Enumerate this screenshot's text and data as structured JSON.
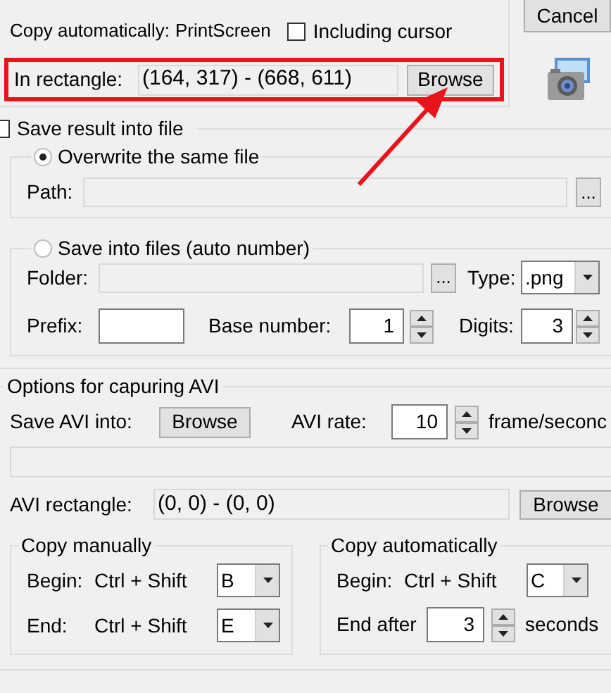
{
  "cancel_button": "Cancel",
  "copy_auto": {
    "label": "Copy automatically:",
    "key": "PrintScreen"
  },
  "including_cursor": {
    "label": "Including cursor",
    "checked": false
  },
  "rectangle": {
    "label": "In rectangle:",
    "value": "(164, 317) - (668, 611)",
    "button": "Browse",
    "highlighted": true
  },
  "save_result": {
    "label": "Save result into file",
    "checked": false
  },
  "overwrite": {
    "label": "Overwrite the same file",
    "selected": true,
    "path_label": "Path:",
    "browse": "..."
  },
  "auto_number": {
    "label": "Save into files (auto number)",
    "selected": false,
    "folder_label": "Folder:",
    "browse": "...",
    "type_label": "Type:",
    "type_value": ".png",
    "prefix_label": "Prefix:",
    "base_label": "Base number:",
    "base_value": "1",
    "digits_label": "Digits:",
    "digits_value": "3"
  },
  "avi": {
    "title": "Options for capuring AVI",
    "save_label": "Save AVI into:",
    "browse": "Browse",
    "rate_label": "AVI rate:",
    "rate_value": "10",
    "rate_unit": "frame/seconc",
    "rect_label": "AVI rectangle:",
    "rect_value": "(0, 0) - (0, 0)",
    "rect_button": "Browse"
  },
  "copy_manually": {
    "title": "Copy manually",
    "rows": [
      {
        "label": "Begin:",
        "keys": "Ctrl + Shift",
        "value": "B"
      },
      {
        "label": "End:",
        "keys": "Ctrl + Shift",
        "value": "E"
      }
    ]
  },
  "copy_automatically": {
    "title": "Copy automatically",
    "begin_label": "Begin:",
    "begin_keys": "Ctrl + Shift",
    "begin_value": "C",
    "end_label": "End after",
    "end_value": "3",
    "end_unit": "seconds"
  }
}
